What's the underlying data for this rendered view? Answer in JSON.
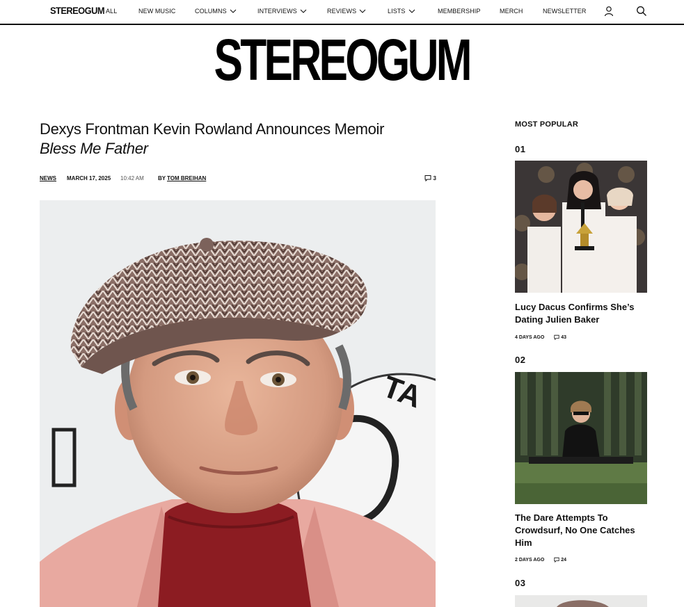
{
  "nav": {
    "logo": "STEREOGUM",
    "items": [
      {
        "label": "ALL",
        "dropdown": false
      },
      {
        "label": "NEW MUSIC",
        "dropdown": false
      },
      {
        "label": "COLUMNS",
        "dropdown": true
      },
      {
        "label": "INTERVIEWS",
        "dropdown": true
      },
      {
        "label": "REVIEWS",
        "dropdown": true
      },
      {
        "label": "LISTS",
        "dropdown": true
      },
      {
        "label": "MEMBERSHIP",
        "dropdown": false
      },
      {
        "label": "MERCH",
        "dropdown": false
      },
      {
        "label": "NEWSLETTER",
        "dropdown": false
      }
    ],
    "icons": [
      "user-icon",
      "search-icon"
    ]
  },
  "masthead": {
    "logo": "STEREOGUM"
  },
  "article": {
    "headline_main": "Dexys Frontman Kevin Rowland Announces Memoir",
    "headline_italic": "Bless Me Father",
    "category": "NEWS",
    "date": "MARCH 17, 2025",
    "time": "10:42 AM",
    "by": "BY",
    "author": "TOM BREIHAN",
    "comment_count": "3"
  },
  "sidebar": {
    "title": "MOST POPULAR",
    "items": [
      {
        "num": "01",
        "headline": "Lucy Dacus Confirms She’s Dating Julien Baker",
        "age": "4 DAYS AGO",
        "comments": "43"
      },
      {
        "num": "02",
        "headline": "The Dare Attempts To Crowdsurf, No One Catches Him",
        "age": "2 DAYS AGO",
        "comments": "24"
      },
      {
        "num": "03",
        "headline": "",
        "age": "",
        "comments": ""
      }
    ]
  },
  "colors": {
    "text": "#111111",
    "border": "#111111",
    "background": "#ffffff"
  }
}
